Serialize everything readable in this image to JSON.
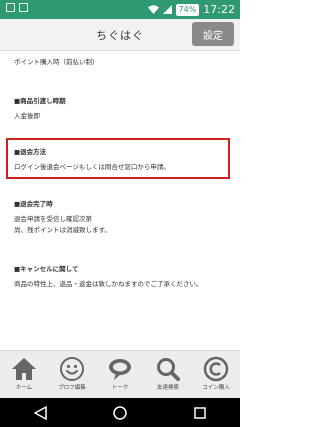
{
  "status_bar": {
    "battery": "74%",
    "time": "17:22"
  },
  "header": {
    "title": "ちぐはぐ",
    "settings_label": "設定"
  },
  "content": {
    "top_line": "ポイント購入時（前払い制）",
    "sections": [
      {
        "title": "■商品引渡し時期",
        "body": [
          "入金後即"
        ]
      },
      {
        "title": "■退会方法",
        "body": [
          "ログイン後退会ページもしくは問合せ窓口から申請。"
        ]
      },
      {
        "title": "■退会完了時",
        "body": [
          "退会申請を受信し確認次第",
          "尚、残ポイントは消滅致します。"
        ]
      },
      {
        "title": "■キャンセルに関して",
        "body": [
          "商品の特性上、返品・返金は致しかねますのでご了承ください。"
        ]
      }
    ]
  },
  "bottom_nav": {
    "items": [
      {
        "label": "ホーム",
        "icon": "home-icon"
      },
      {
        "label": "プロフ編集",
        "icon": "smiley-icon"
      },
      {
        "label": "トーク",
        "icon": "chat-bubble-icon"
      },
      {
        "label": "友達検索",
        "icon": "search-icon"
      },
      {
        "label": "コイン購入",
        "icon": "coin-icon"
      }
    ]
  },
  "colors": {
    "status_bar": "#2f9a72",
    "highlight_border": "#d0201e",
    "settings_button": "#8a8a8a"
  }
}
